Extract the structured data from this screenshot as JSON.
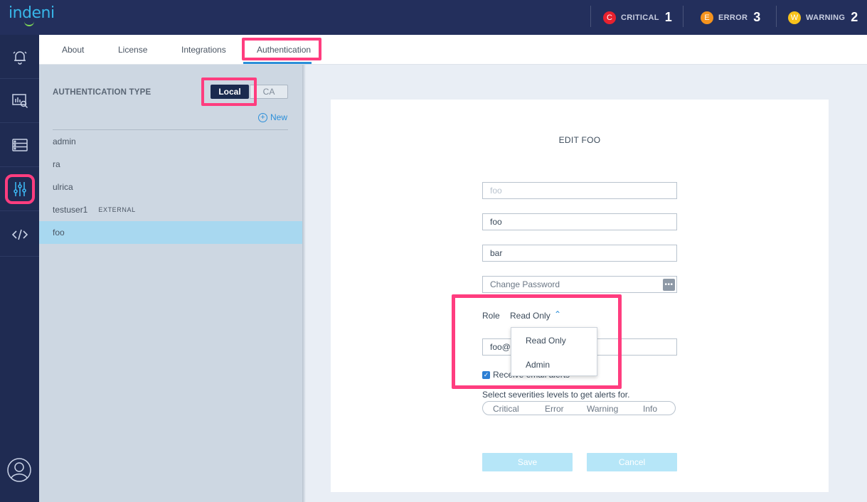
{
  "header": {
    "logo": "indeni",
    "alerts": [
      {
        "key": "critical",
        "letter": "C",
        "label": "CRITICAL",
        "count": "1",
        "color": "#e8212e"
      },
      {
        "key": "error",
        "letter": "E",
        "label": "ERROR",
        "count": "3",
        "color": "#f5931e"
      },
      {
        "key": "warning",
        "letter": "W",
        "label": "WARNING",
        "count": "2",
        "color": "#f7c21b"
      }
    ]
  },
  "nav": {
    "items": [
      {
        "name": "alerts-bell-icon"
      },
      {
        "name": "analytics-monitor-icon"
      },
      {
        "name": "devices-server-icon"
      },
      {
        "name": "settings-sliders-icon",
        "active": true
      },
      {
        "name": "code-icon"
      }
    ],
    "user_icon": "user-profile-icon"
  },
  "tabs": [
    {
      "label": "About"
    },
    {
      "label": "License"
    },
    {
      "label": "Integrations"
    },
    {
      "label": "Authentication",
      "active": true
    }
  ],
  "left_panel": {
    "auth_type_label": "AUTHENTICATION TYPE",
    "toggle": {
      "local": "Local",
      "ca": "CA",
      "selected": "Local"
    },
    "new_label": "New",
    "users": [
      {
        "name": "admin",
        "badge": ""
      },
      {
        "name": "ra",
        "badge": ""
      },
      {
        "name": "ulrica",
        "badge": ""
      },
      {
        "name": "testuser1",
        "badge": "EXTERNAL"
      },
      {
        "name": "foo",
        "badge": "",
        "selected": true
      }
    ]
  },
  "edit_form": {
    "title": "EDIT FOO",
    "username_placeholder": "foo",
    "first_name": "foo",
    "last_name": "bar",
    "password_placeholder": "Change Password",
    "role_label": "Role",
    "role_value": "Read Only",
    "role_options": [
      "Read Only",
      "Admin"
    ],
    "email_visible": "foo@i",
    "receive_alerts_label": "Receive email alerts",
    "receive_alerts_checked": true,
    "severity_prompt": "Select severities levels to get alerts for.",
    "severities": [
      "Critical",
      "Error",
      "Warning",
      "Info"
    ],
    "save_label": "Save",
    "cancel_label": "Cancel"
  },
  "colors": {
    "accent": "#2c8fd9",
    "highlight": "#ff3d7f",
    "topbar": "#232f5c",
    "selected_row": "#a8d8f0"
  }
}
